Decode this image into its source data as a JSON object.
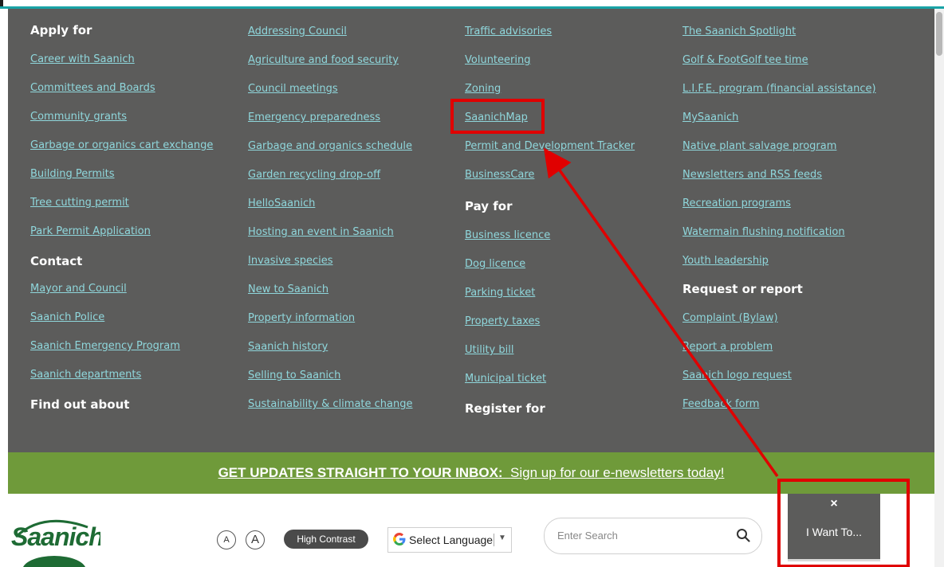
{
  "menu": {
    "col1": [
      {
        "type": "heading",
        "text": "Apply for"
      },
      {
        "type": "link",
        "text": "Career with Saanich"
      },
      {
        "type": "link",
        "text": "Committees and Boards"
      },
      {
        "type": "link",
        "text": "Community grants"
      },
      {
        "type": "link",
        "text": "Garbage or organics cart exchange"
      },
      {
        "type": "link",
        "text": "Building Permits"
      },
      {
        "type": "link",
        "text": "Tree cutting permit"
      },
      {
        "type": "link",
        "text": "Park Permit Application"
      },
      {
        "type": "heading",
        "text": "Contact"
      },
      {
        "type": "link",
        "text": "Mayor and Council"
      },
      {
        "type": "link",
        "text": "Saanich Police"
      },
      {
        "type": "link",
        "text": "Saanich Emergency Program"
      },
      {
        "type": "link",
        "text": "Saanich departments"
      },
      {
        "type": "heading",
        "text": "Find out about"
      }
    ],
    "col2": [
      "Addressing Council",
      "Agriculture and food security",
      "Council meetings",
      "Emergency preparedness",
      "Garbage and organics schedule",
      "Garden recycling drop-off",
      "HelloSaanich",
      "Hosting an event in Saanich",
      "Invasive species",
      "New to Saanich",
      "Property information",
      "Saanich history",
      "Selling to Saanich",
      "Sustainability & climate change"
    ],
    "col3": [
      {
        "type": "link",
        "text": "Traffic advisories"
      },
      {
        "type": "link",
        "text": "Volunteering"
      },
      {
        "type": "link",
        "text": "Zoning"
      },
      {
        "type": "link",
        "text": "SaanichMap"
      },
      {
        "type": "link",
        "text": "Permit and Development Tracker"
      },
      {
        "type": "link",
        "text": "BusinessCare"
      },
      {
        "type": "heading",
        "text": "Pay for"
      },
      {
        "type": "link",
        "text": "Business licence"
      },
      {
        "type": "link",
        "text": "Dog licence"
      },
      {
        "type": "link",
        "text": "Parking ticket"
      },
      {
        "type": "link",
        "text": "Property taxes"
      },
      {
        "type": "link",
        "text": "Utility bill"
      },
      {
        "type": "link",
        "text": "Municipal ticket"
      },
      {
        "type": "heading",
        "text": "Register for"
      }
    ],
    "col4": [
      {
        "type": "link",
        "text": "The Saanich Spotlight"
      },
      {
        "type": "link",
        "text": "Golf & FootGolf tee time"
      },
      {
        "type": "link",
        "text": "L.I.F.E. program (financial assistance)"
      },
      {
        "type": "link",
        "text": "MySaanich"
      },
      {
        "type": "link",
        "text": "Native plant salvage program"
      },
      {
        "type": "link",
        "text": "Newsletters and RSS feeds"
      },
      {
        "type": "link",
        "text": "Recreation programs"
      },
      {
        "type": "link",
        "text": "Watermain flushing notification"
      },
      {
        "type": "link",
        "text": "Youth leadership"
      },
      {
        "type": "heading",
        "text": "Request or report"
      },
      {
        "type": "link",
        "text": "Complaint (Bylaw)"
      },
      {
        "type": "link",
        "text": "Report a problem"
      },
      {
        "type": "link",
        "text": "Saanich logo request"
      },
      {
        "type": "link",
        "text": "Feedback form"
      }
    ]
  },
  "banner": {
    "bold": "GET UPDATES STRAIGHT TO YOUR INBOX:",
    "link": "Sign up for our e-newsletters today!"
  },
  "footer": {
    "logo": "Saanich",
    "font_small": "A",
    "font_large": "A",
    "high_contrast": "High Contrast",
    "language": "Select Language",
    "search_placeholder": "Enter Search"
  },
  "iwant": {
    "close": "×",
    "label": "I Want To..."
  },
  "colors": {
    "menu_bg": "#5c5c5b",
    "link": "#8fd7dc",
    "banner": "#6f9a3a",
    "annotation": "#e00000",
    "brand": "#1e6b34"
  }
}
